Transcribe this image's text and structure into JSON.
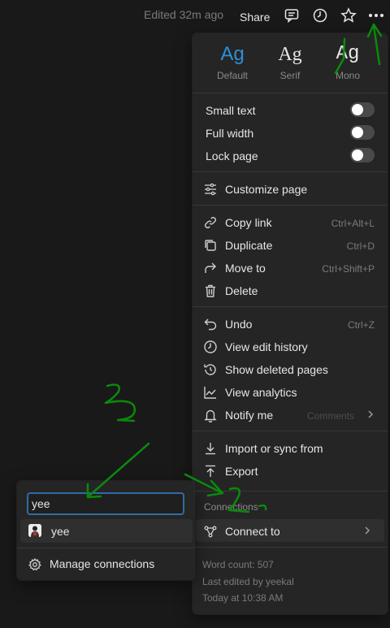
{
  "topbar": {
    "edited": "Edited 32m ago",
    "share": "Share",
    "icons": [
      "comment-icon",
      "history-icon",
      "star-icon",
      "more-icon"
    ]
  },
  "menu": {
    "fonts": [
      {
        "sample": "Ag",
        "label": "Default",
        "color": "#2f8fd8"
      },
      {
        "sample": "Ag",
        "label": "Serif",
        "color": "#e6e6e6"
      },
      {
        "sample": "Ag",
        "label": "Mono",
        "color": "#e6e6e6"
      }
    ],
    "toggles": [
      {
        "label": "Small text",
        "on": false
      },
      {
        "label": "Full width",
        "on": false
      },
      {
        "label": "Lock page",
        "on": false
      }
    ],
    "customize": "Customize page",
    "page_actions": [
      {
        "label": "Copy link",
        "shortcut": "Ctrl+Alt+L",
        "icon": "link-icon"
      },
      {
        "label": "Duplicate",
        "shortcut": "Ctrl+D",
        "icon": "duplicate-icon"
      },
      {
        "label": "Move to",
        "shortcut": "Ctrl+Shift+P",
        "icon": "move-icon"
      },
      {
        "label": "Delete",
        "shortcut": "",
        "icon": "trash-icon"
      }
    ],
    "history_actions": [
      {
        "label": "Undo",
        "shortcut": "Ctrl+Z",
        "icon": "undo-icon"
      },
      {
        "label": "View edit history",
        "shortcut": "",
        "icon": "history-icon"
      },
      {
        "label": "Show deleted pages",
        "shortcut": "",
        "icon": "restore-icon"
      },
      {
        "label": "View analytics",
        "shortcut": "",
        "icon": "analytics-icon"
      },
      {
        "label": "Notify me",
        "shortcut": "",
        "icon": "bell-icon",
        "faded": "Comments"
      }
    ],
    "import_export": [
      {
        "label": "Import or sync from",
        "icon": "import-icon"
      },
      {
        "label": "Export",
        "icon": "export-icon"
      }
    ],
    "connections_label": "Connections",
    "connect_to": "Connect to",
    "footer": {
      "word_count": "Word count: 507",
      "last_edited": "Last edited by yeekal",
      "date": "Today at 10:38 AM"
    }
  },
  "submenu": {
    "search_value": "yee",
    "result": "yee",
    "manage": "Manage connections"
  },
  "annotations": [
    "1",
    "2",
    "3"
  ],
  "colors": {
    "annotation": "#0a8a0a",
    "accent": "#2f8fd8",
    "input_border": "#2e6da4"
  }
}
